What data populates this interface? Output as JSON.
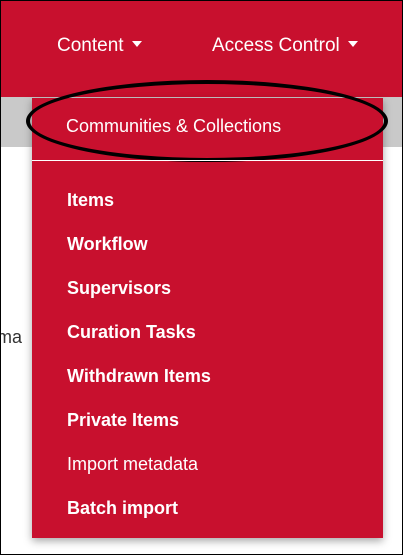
{
  "nav": {
    "content_label": "Content",
    "access_label": "Access Control"
  },
  "background": {
    "fragment_big": "",
    "fragment_small": "ma"
  },
  "dropdown": {
    "header": "Communities & Collections",
    "items": [
      {
        "label": "Items",
        "bold": true
      },
      {
        "label": "Workflow",
        "bold": true
      },
      {
        "label": "Supervisors",
        "bold": true
      },
      {
        "label": "Curation Tasks",
        "bold": true
      },
      {
        "label": "Withdrawn Items",
        "bold": true
      },
      {
        "label": "Private Items",
        "bold": true
      },
      {
        "label": "Import metadata",
        "bold": false
      },
      {
        "label": "Batch import",
        "bold": true
      }
    ]
  },
  "colors": {
    "brand_red": "#c8102e",
    "gray_bar": "#c9c9c9",
    "text": "#ffffff"
  }
}
